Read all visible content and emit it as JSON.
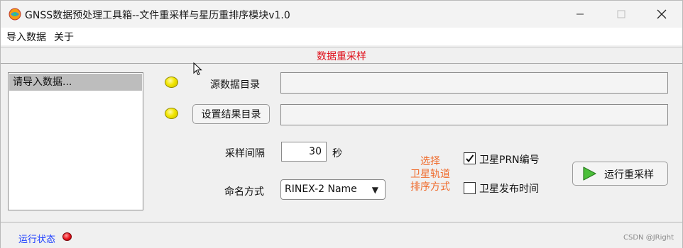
{
  "window": {
    "title": "GNSS数据预处理工具箱--文件重采样与星历重排序模块v1.0"
  },
  "menu": {
    "items": [
      {
        "label": "导入数据"
      },
      {
        "label": "关于"
      }
    ]
  },
  "section": {
    "title": "数据重采样",
    "title_color": "#e0111b"
  },
  "file_list": {
    "items": [
      "请导入数据..."
    ]
  },
  "source_dir": {
    "label": "源数据目录",
    "value": "",
    "indicator_color": "#f2e600"
  },
  "result_dir": {
    "button_label": "设置结果目录",
    "value": "",
    "indicator_color": "#f2e600"
  },
  "sampling": {
    "label": "采样间隔",
    "value": "30",
    "unit": "秒"
  },
  "naming": {
    "label": "命名方式",
    "selected": "RINEX-2 Name"
  },
  "orbit_sort": {
    "caption_lines": [
      "选择",
      "卫星轨道",
      "排序方式"
    ],
    "caption_color": "#ef6b2c",
    "options": [
      {
        "label": "卫星PRN编号",
        "checked": true
      },
      {
        "label": "卫星发布时间",
        "checked": false
      }
    ]
  },
  "run": {
    "label": "运行重采样",
    "icon": "play-icon"
  },
  "status": {
    "label": "运行状态",
    "indicator_color": "#e8101a"
  },
  "watermark": "CSDN @JRight"
}
